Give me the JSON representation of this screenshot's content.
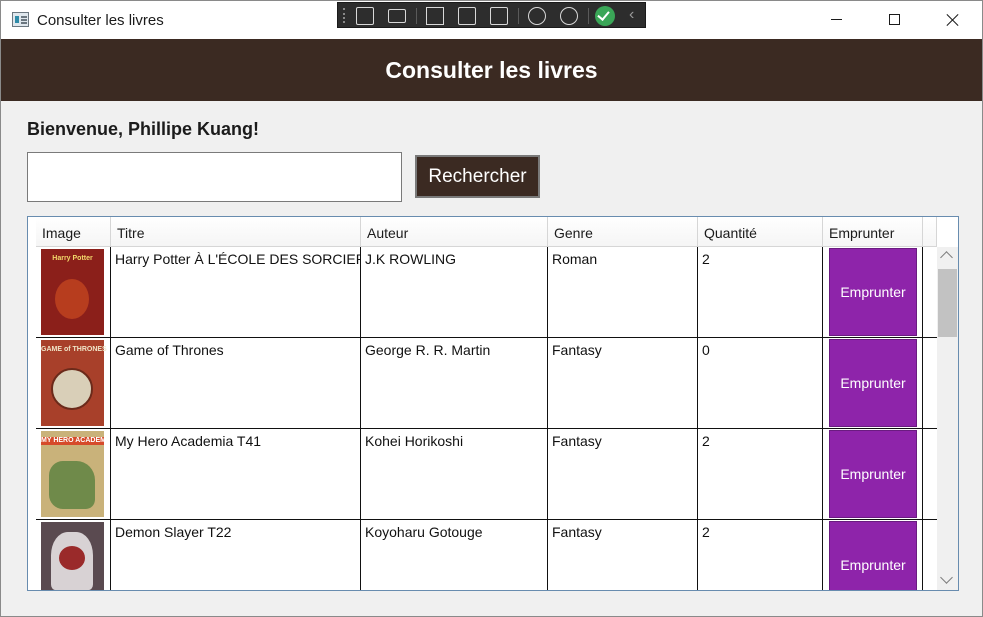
{
  "window": {
    "title": "Consulter les livres",
    "icons": [
      "app-icon",
      "minimize-icon",
      "maximize-icon",
      "close-icon"
    ]
  },
  "dev_toolbar": {
    "icons": [
      "live-visual-tree-icon",
      "video-icon",
      "select-element-icon",
      "layout-adorner-icon",
      "track-focus-icon",
      "binding-failures-icon",
      "accessibility-icon",
      "check-icon",
      "collapse-chevron-icon"
    ]
  },
  "header": {
    "title": "Consulter les livres",
    "background": "#3b2a22"
  },
  "welcome": "Bienvenue, Phillipe Kuang!",
  "search": {
    "value": "",
    "button_label": "Rechercher"
  },
  "table": {
    "columns": [
      "Image",
      "Titre",
      "Auteur",
      "Genre",
      "Quantité",
      "Emprunter"
    ],
    "rows": [
      {
        "title": "Harry Potter À L'ÉCOLE DES SORCIERS",
        "author": "J.K ROWLING",
        "genre": "Roman",
        "quantity": "2",
        "button": "Emprunter",
        "cover": "harry-potter-cover",
        "cover_color": "#8b1f1a"
      },
      {
        "title": "Game of Thrones",
        "author": "George R. R. Martin",
        "genre": "Fantasy",
        "quantity": "0",
        "button": "Emprunter",
        "cover": "game-of-thrones-cover",
        "cover_color": "#a8402a"
      },
      {
        "title": "My Hero Academia T41",
        "author": "Kohei Horikoshi",
        "genre": "Fantasy",
        "quantity": "2",
        "button": "Emprunter",
        "cover": "my-hero-academia-cover",
        "cover_color": "#c9b27a"
      },
      {
        "title": "Demon Slayer T22",
        "author": "Koyoharu Gotouge",
        "genre": "Fantasy",
        "quantity": "2",
        "button": "Emprunter",
        "cover": "demon-slayer-cover",
        "cover_color": "#5a4a50"
      }
    ]
  },
  "colors": {
    "accent_button": "#8e24aa",
    "grid_border": "#688caf"
  }
}
